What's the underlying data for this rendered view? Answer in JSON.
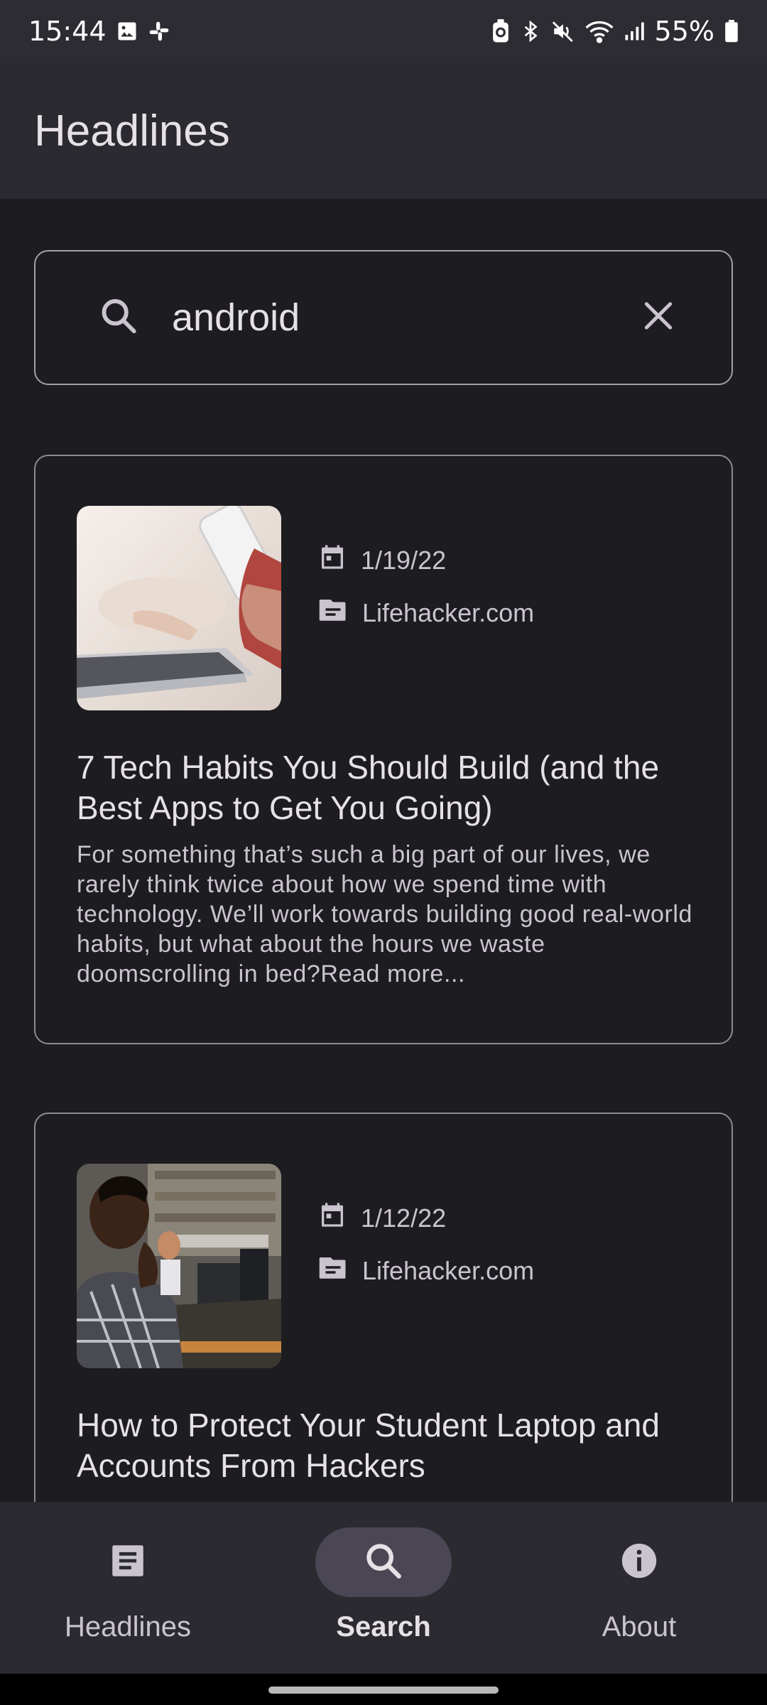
{
  "status_bar": {
    "time": "15:44",
    "left_icons": [
      "gallery-icon",
      "slack-icon"
    ],
    "right_icons": [
      "battery-saver-icon",
      "bluetooth-icon",
      "mute-icon",
      "wifi-icon",
      "signal-icon"
    ],
    "battery": "55%"
  },
  "app_bar": {
    "title": "Headlines"
  },
  "search": {
    "value": "android",
    "placeholder": ""
  },
  "articles": [
    {
      "date": "1/19/22",
      "source": "Lifehacker.com",
      "title": "7 Tech Habits You Should Build (and the Best Apps to Get You Going)",
      "summary": "For something that’s such a big part of our lives, we rarely think twice about how we spend time with technology. We’ll work towards building good real-world habits, but what about the hours we waste doomscrolling in bed?Read more..."
    },
    {
      "date": "1/12/22",
      "source": "Lifehacker.com",
      "title": "How to Protect Your Student Laptop and Accounts From Hackers"
    }
  ],
  "bottom_nav": {
    "items": [
      {
        "label": "Headlines",
        "icon": "article-icon",
        "active": false
      },
      {
        "label": "Search",
        "icon": "search-icon",
        "active": true
      },
      {
        "label": "About",
        "icon": "info-icon",
        "active": false
      }
    ]
  },
  "colors": {
    "background": "#1d1c20",
    "surface": "#2b2a31",
    "outline": "#8e8a94",
    "active_indicator": "#4b4654"
  }
}
